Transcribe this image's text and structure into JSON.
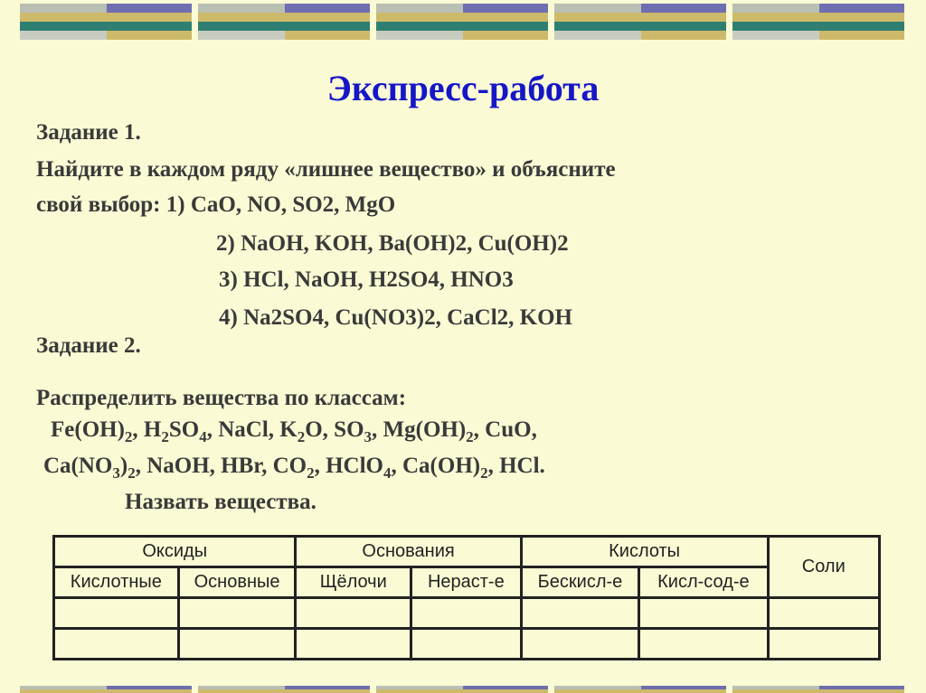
{
  "title": "Экспресс-работа",
  "task1": {
    "heading": "Задание 1.",
    "prompt_line1": "Найдите в каждом ряду «лишнее вещество» и объясните",
    "prompt_line2_prefix": "свой выбор: ",
    "rows": [
      "1) CaO, NO, SO2, MgO",
      "2) NaOH, KOH, Ba(OH)2, Cu(OH)2",
      "3) HCl, NaOH, H2SO4, HNO3",
      "4) Na2SO4, Cu(NO3)2, CaCl2, KOH"
    ]
  },
  "task2": {
    "heading": "Задание 2.",
    "prompt": "Распределить вещества по классам:",
    "substances_line1": {
      "a1": "Fe(OH)",
      "a2": "2",
      "a3": ", H",
      "a4": "2",
      "a5": "SO",
      "a6": "4",
      "a7": ", NaCl, K",
      "a8": "2",
      "a9": "O, SO",
      "a10": "3",
      "a11": ", Mg(OH)",
      "a12": "2",
      "a13": ", CuO,"
    },
    "substances_line2": {
      "b1": "Ca(NO",
      "b2": "3",
      "b3": ")",
      "b4": "2",
      "b5": ", NaOH, HBr, CO",
      "b6": "2",
      "b7": ", HClO",
      "b8": "4",
      "b9": ", Ca(OH)",
      "b10": "2",
      "b11": ", HCl."
    },
    "name_prompt": "Назвать вещества."
  },
  "table": {
    "group_headers": {
      "oxides": "Оксиды",
      "bases": "Основания",
      "acids": "Кислоты",
      "salts": "Соли"
    },
    "sub_headers": [
      "Кислотные",
      "Основные",
      "Щёлочи",
      "Нераст-е",
      "Бескисл-е",
      "Кисл-сод-е"
    ]
  },
  "colors": {
    "background": "#FAFAD4",
    "title": "#1616C8",
    "text": "#3a3a3a",
    "deco_tan": "#CDB96A",
    "deco_teal": "#2E7F72",
    "deco_blue": "#6E6EB0",
    "deco_gray": "#B7BFB3"
  }
}
